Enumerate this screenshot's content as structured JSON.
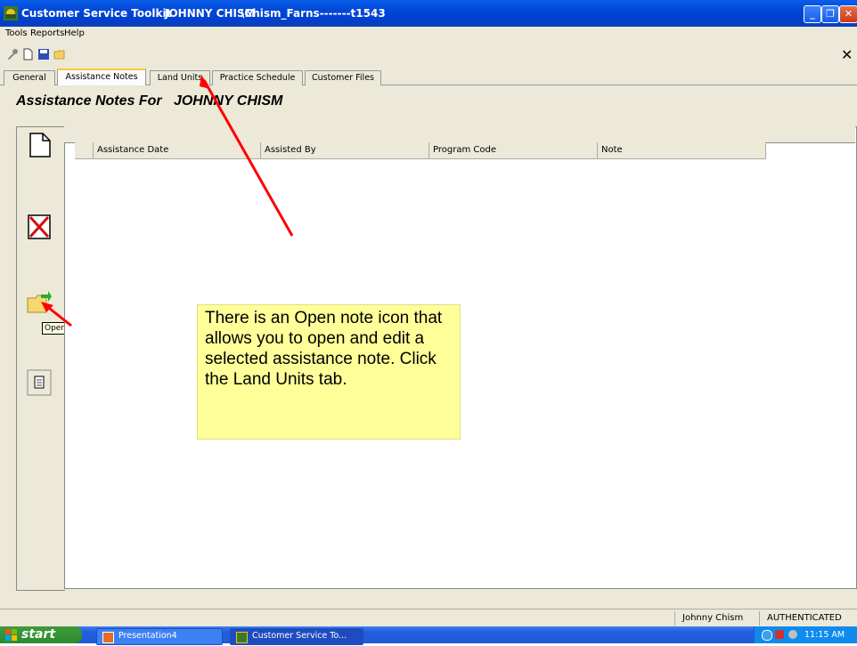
{
  "window": {
    "app_title": "Customer Service Toolkit",
    "user_title": "JOHNNY CHISM",
    "path_title": "\\Chism_Farns-------t1543"
  },
  "menu": {
    "items": [
      "Tools",
      "Reports",
      "Help"
    ]
  },
  "tabs": [
    "General",
    "Assistance Notes",
    "Land Units",
    "Practice Schedule",
    "Customer Files"
  ],
  "active_tab": "Assistance Notes",
  "heading": {
    "prefix": "Assistance Notes For",
    "name": "JOHNNY CHISM"
  },
  "grid": {
    "columns": [
      "Assistance Date",
      "Assisted By",
      "Program Code",
      "Note"
    ],
    "rows": []
  },
  "sidebar": {
    "buttons": [
      {
        "name": "new-note",
        "icon": "new-page-icon"
      },
      {
        "name": "delete-note",
        "icon": "red-x-icon"
      },
      {
        "name": "open-note",
        "icon": "open-folder-icon"
      },
      {
        "name": "print-note",
        "icon": "notepad-icon"
      }
    ],
    "tooltip": "Open note"
  },
  "callout": {
    "text": "There is an Open note icon that allows you to open and edit a selected assistance note. Click the Land Units tab."
  },
  "status": {
    "user": "Johnny Chism",
    "auth": "AUTHENTICATED"
  },
  "taskbar": {
    "start": "start",
    "items": [
      "Presentation4",
      "Customer Service To..."
    ],
    "time": "11:15 AM"
  },
  "colors": {
    "annotation_arrow": "#ff0000",
    "callout_bg": "#ffff99",
    "titlebar": "#0046d8"
  }
}
